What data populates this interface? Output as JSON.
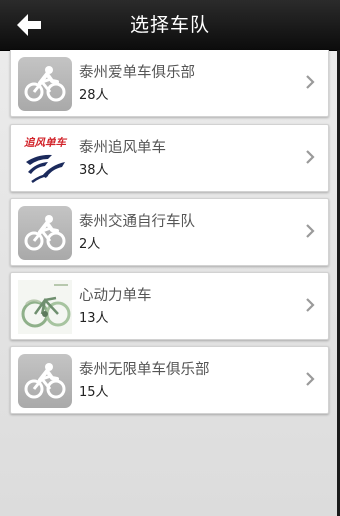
{
  "header": {
    "title": "选择车队",
    "back_icon": "back-arrow-icon"
  },
  "teams": [
    {
      "name": "泰州爱单车俱乐部",
      "count": "28人",
      "logo": "cyclist-icon"
    },
    {
      "name": "泰州追风单车",
      "count": "38人",
      "logo": "zhuifeng-logo",
      "logo_text": "追风单车"
    },
    {
      "name": "泰州交通自行车队",
      "count": "2人",
      "logo": "cyclist-icon"
    },
    {
      "name": "心动力单车",
      "count": "13人",
      "logo": "bicycle-photo"
    },
    {
      "name": "泰州无限单车俱乐部",
      "count": "15人",
      "logo": "cyclist-icon"
    }
  ],
  "colors": {
    "header_bg": "#111111",
    "header_text": "#ffffff",
    "logo_red": "#d2232a",
    "logo_navy": "#1b2a5c"
  }
}
